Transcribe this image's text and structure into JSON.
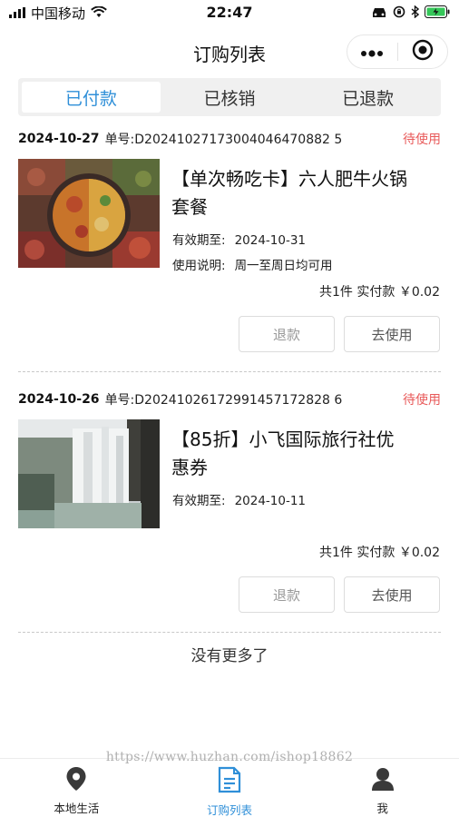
{
  "status_bar": {
    "carrier": "中国移动",
    "time": "22:47"
  },
  "nav": {
    "title": "订购列表"
  },
  "tabs": [
    {
      "label": "已付款",
      "active": true
    },
    {
      "label": "已核销",
      "active": false
    },
    {
      "label": "已退款",
      "active": false
    }
  ],
  "orders": [
    {
      "date": "2024-10-27",
      "order_no": "单号:D20241027173004046470882 5",
      "status": "待使用",
      "title_line1": "【单次畅吃卡】六人肥牛火锅",
      "title_line2": "套餐",
      "valid_label": "有效期至:",
      "valid_date": "2024-10-31",
      "usage_label": "使用说明:",
      "usage_text": "周一至周日均可用",
      "total": "共1件 实付款 ￥0.02",
      "refund_label": "退款",
      "use_label": "去使用"
    },
    {
      "date": "2024-10-26",
      "order_no": "单号:D20241026172991457172828 6",
      "status": "待使用",
      "title_line1": "【85折】小飞国际旅行社优",
      "title_line2": "惠券",
      "valid_label": "有效期至:",
      "valid_date": "2024-10-11",
      "total": "共1件 实付款 ￥0.02",
      "refund_label": "退款",
      "use_label": "去使用"
    }
  ],
  "footer": {
    "no_more": "没有更多了",
    "watermark": "https://www.huzhan.com/ishop18862"
  },
  "tabbar": [
    {
      "label": "本地生活",
      "icon": "location-pin-icon",
      "active": false
    },
    {
      "label": "订购列表",
      "icon": "document-list-icon",
      "active": true
    },
    {
      "label": "我",
      "icon": "person-icon",
      "active": false
    }
  ],
  "colors": {
    "accent": "#2f8fd8",
    "status": "#e85a5a"
  }
}
